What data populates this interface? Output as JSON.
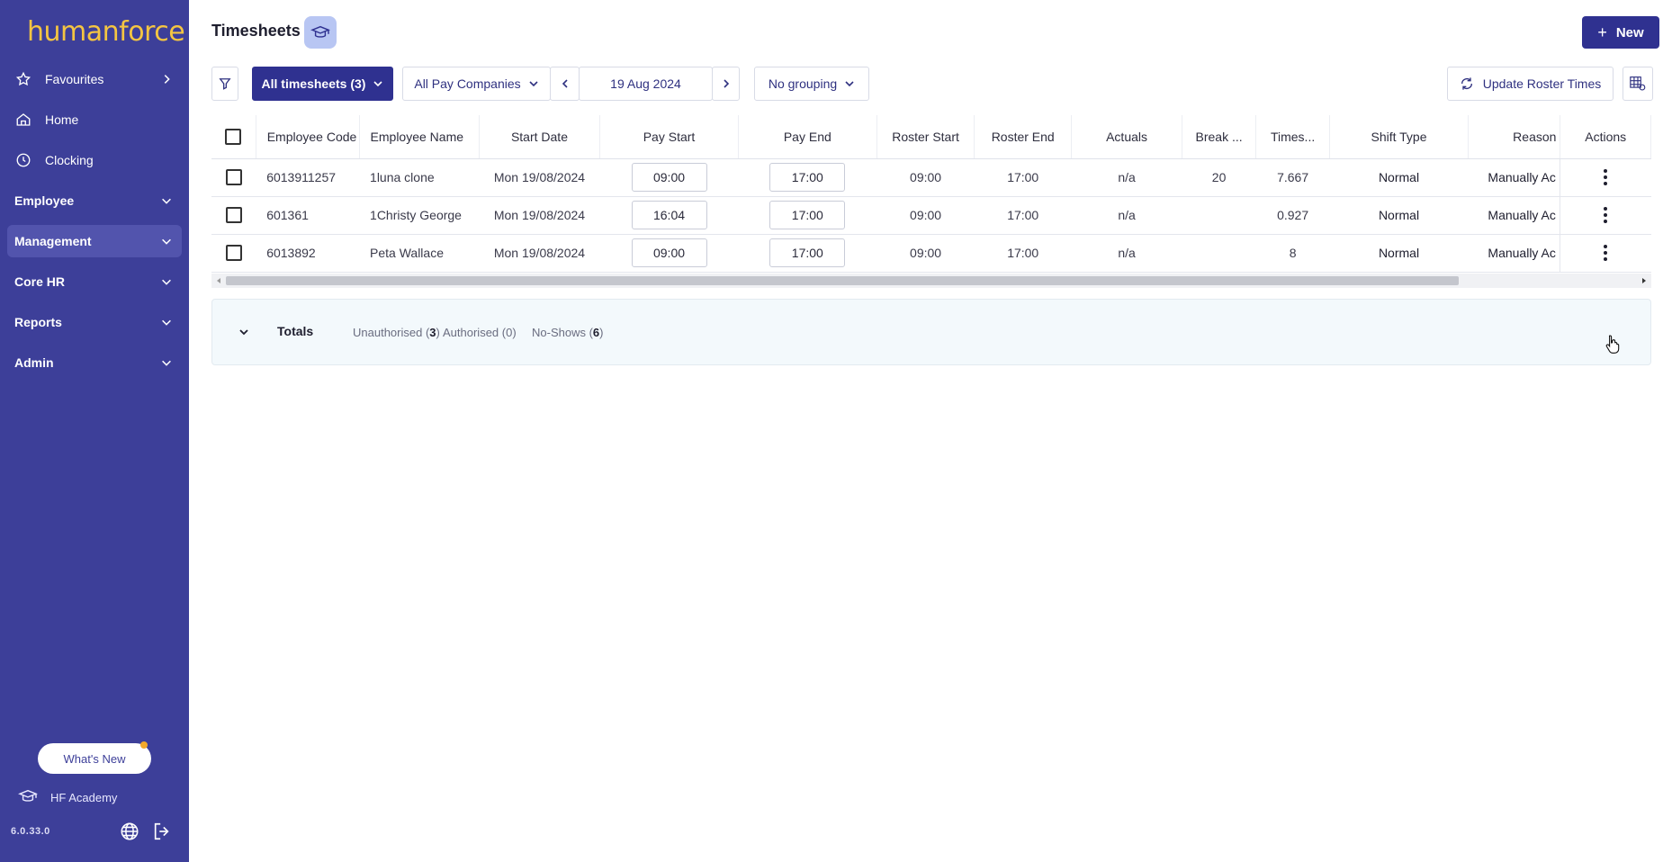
{
  "app": {
    "brand": "humanforce",
    "version": "6.0.33.0"
  },
  "sidebar": {
    "items": [
      {
        "label": "Favourites",
        "icon": "star-icon"
      },
      {
        "label": "Home",
        "icon": "home-icon"
      },
      {
        "label": "Clocking",
        "icon": "clock-icon"
      }
    ],
    "sections": [
      {
        "label": "Employee"
      },
      {
        "label": "Management"
      },
      {
        "label": "Core HR"
      },
      {
        "label": "Reports"
      },
      {
        "label": "Admin"
      }
    ],
    "whats_new": "What's New",
    "academy": "HF Academy"
  },
  "header": {
    "title": "Timesheets",
    "new_label": "New"
  },
  "toolbar": {
    "view_label": "All timesheets (3)",
    "pay_company": "All Pay Companies",
    "date": "19 Aug 2024",
    "grouping": "No grouping",
    "update_roster": "Update Roster Times"
  },
  "table": {
    "columns": [
      "Employee Code",
      "Employee Name",
      "Start Date",
      "Pay Start",
      "Pay End",
      "Roster Start",
      "Roster End",
      "Actuals",
      "Break ...",
      "Times...",
      "Shift Type",
      "Reason",
      "Actions"
    ],
    "rows": [
      {
        "code": "6013911257",
        "name": "1luna clone",
        "start_date": "Mon 19/08/2024",
        "pay_start": "09:00",
        "pay_end": "17:00",
        "roster_start": "09:00",
        "roster_end": "17:00",
        "actuals": "n/a",
        "break": "20",
        "times": "7.667",
        "shift_type": "Normal",
        "reason": "Manually Ac"
      },
      {
        "code": "601361",
        "name": "1Christy George",
        "start_date": "Mon 19/08/2024",
        "pay_start": "16:04",
        "pay_end": "17:00",
        "roster_start": "09:00",
        "roster_end": "17:00",
        "actuals": "n/a",
        "break": "",
        "times": "0.927",
        "shift_type": "Normal",
        "reason": "Manually Ac"
      },
      {
        "code": "6013892",
        "name": "Peta Wallace",
        "start_date": "Mon 19/08/2024",
        "pay_start": "09:00",
        "pay_end": "17:00",
        "roster_start": "09:00",
        "roster_end": "17:00",
        "actuals": "n/a",
        "break": "",
        "times": "8",
        "shift_type": "Normal",
        "reason": "Manually Ac"
      }
    ]
  },
  "totals": {
    "label": "Totals",
    "unauthorised_label": "Unauthorised (",
    "unauthorised_count": "3",
    "authorised": "Authorised (0)",
    "noshows_label": "No-Shows (",
    "noshows_count": "6",
    "close_paren": ")"
  },
  "colors": {
    "sidebar": "#3d3f99",
    "primary": "#2f3190",
    "brand": "#f4c542"
  }
}
